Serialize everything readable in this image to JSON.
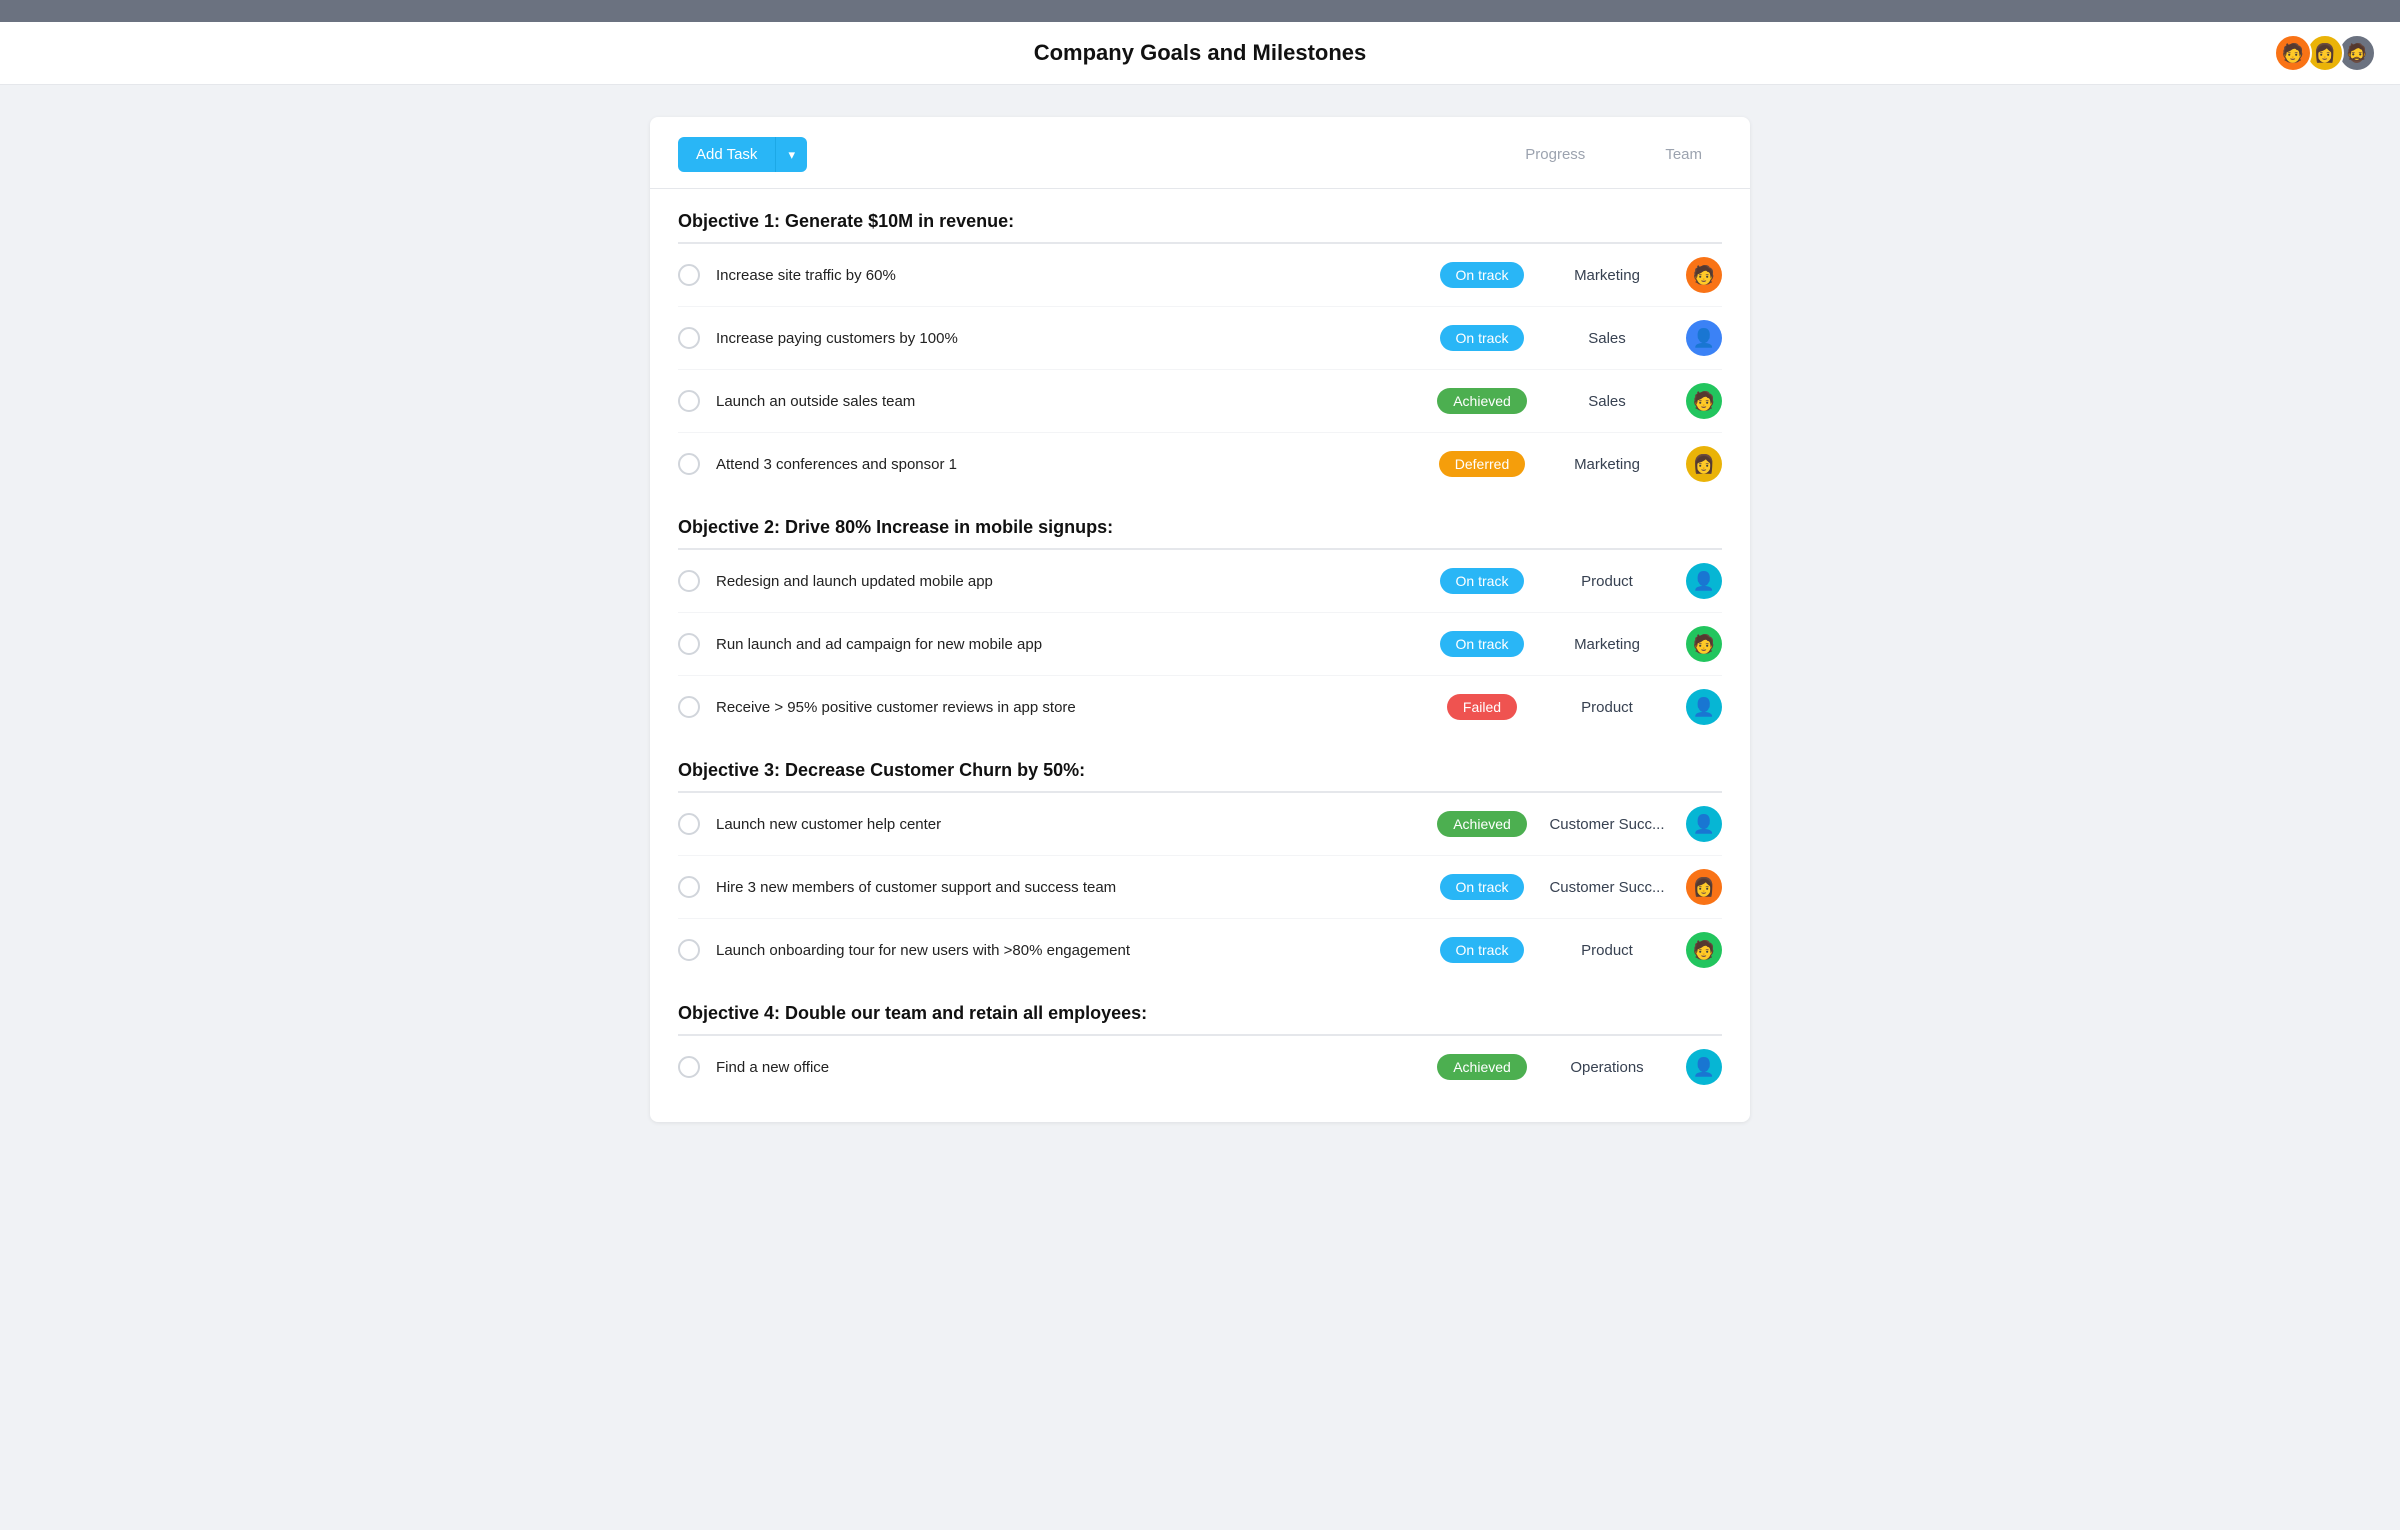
{
  "topbar": {},
  "header": {
    "title": "Company Goals and Milestones",
    "avatars": [
      {
        "emoji": "🧑",
        "color": "#f97316"
      },
      {
        "emoji": "👩",
        "color": "#eab308"
      },
      {
        "emoji": "🧔",
        "color": "#6b7280"
      }
    ]
  },
  "toolbar": {
    "add_task_label": "Add Task",
    "col_progress": "Progress",
    "col_team": "Team"
  },
  "objectives": [
    {
      "title": "Objective 1: Generate $10M in revenue:",
      "tasks": [
        {
          "label": "Increase site traffic by 60%",
          "status": "On track",
          "status_type": "on-track",
          "team": "Marketing",
          "avatar_emoji": "🧑",
          "avatar_color": "#f97316"
        },
        {
          "label": "Increase paying customers by 100%",
          "status": "On track",
          "status_type": "on-track",
          "team": "Sales",
          "avatar_emoji": "👤",
          "avatar_color": "#3b82f6"
        },
        {
          "label": "Launch an outside sales team",
          "status": "Achieved",
          "status_type": "achieved",
          "team": "Sales",
          "avatar_emoji": "🧑",
          "avatar_color": "#22c55e"
        },
        {
          "label": "Attend 3 conferences and sponsor 1",
          "status": "Deferred",
          "status_type": "deferred",
          "team": "Marketing",
          "avatar_emoji": "👩",
          "avatar_color": "#eab308"
        }
      ]
    },
    {
      "title": "Objective 2: Drive 80% Increase in mobile signups:",
      "tasks": [
        {
          "label": "Redesign and launch updated mobile app",
          "status": "On track",
          "status_type": "on-track",
          "team": "Product",
          "avatar_emoji": "👤",
          "avatar_color": "#06b6d4"
        },
        {
          "label": "Run launch and ad campaign for new mobile app",
          "status": "On track",
          "status_type": "on-track",
          "team": "Marketing",
          "avatar_emoji": "🧑",
          "avatar_color": "#22c55e"
        },
        {
          "label": "Receive > 95% positive customer reviews in app store",
          "status": "Failed",
          "status_type": "failed",
          "team": "Product",
          "avatar_emoji": "👤",
          "avatar_color": "#06b6d4"
        }
      ]
    },
    {
      "title": "Objective 3: Decrease Customer Churn by 50%:",
      "tasks": [
        {
          "label": "Launch new customer help center",
          "status": "Achieved",
          "status_type": "achieved",
          "team": "Customer Succ...",
          "avatar_emoji": "👤",
          "avatar_color": "#06b6d4"
        },
        {
          "label": "Hire 3 new members of customer support and success team",
          "status": "On track",
          "status_type": "on-track",
          "team": "Customer Succ...",
          "avatar_emoji": "👩",
          "avatar_color": "#f97316"
        },
        {
          "label": "Launch onboarding tour for new users with >80% engagement",
          "status": "On track",
          "status_type": "on-track",
          "team": "Product",
          "avatar_emoji": "🧑",
          "avatar_color": "#22c55e"
        }
      ]
    },
    {
      "title": "Objective 4: Double our team and retain all employees:",
      "tasks": [
        {
          "label": "Find a new office",
          "status": "Achieved",
          "status_type": "achieved",
          "team": "Operations",
          "avatar_emoji": "👤",
          "avatar_color": "#06b6d4"
        }
      ]
    }
  ]
}
